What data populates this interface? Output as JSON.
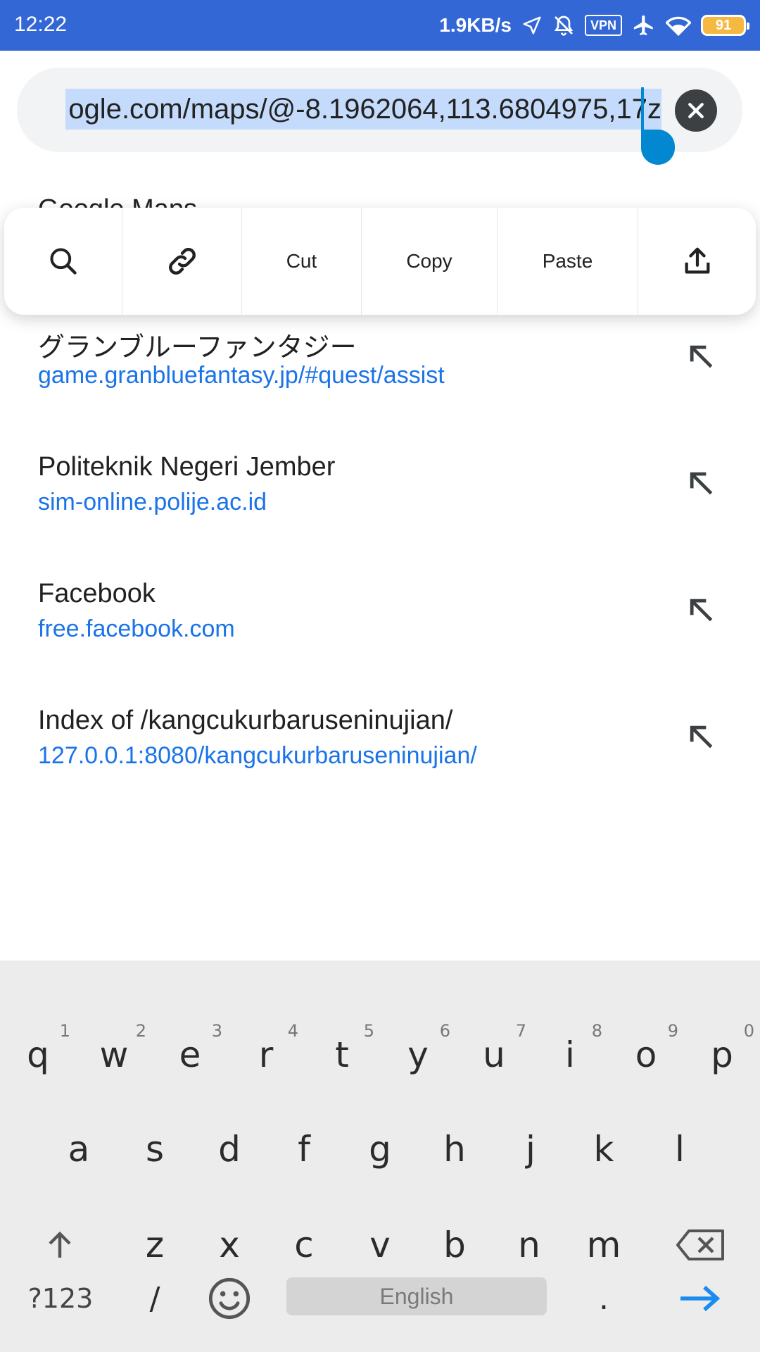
{
  "status_bar": {
    "time": "12:22",
    "net_speed": "1.9KB/s",
    "vpn": "VPN",
    "battery": "91"
  },
  "url_bar": {
    "text": "ogle.com/maps/@-8.1962064,113.6804975,17z"
  },
  "hidden_suggestion_title": "Google Maps",
  "context_menu": {
    "cut": "Cut",
    "copy": "Copy",
    "paste": "Paste"
  },
  "suggestions": [
    {
      "title": "グランブルーファンタジー",
      "url": "game.granbluefantasy.jp/#quest/assist"
    },
    {
      "title": "Politeknik Negeri Jember",
      "url": "sim-online.polije.ac.id"
    },
    {
      "title": "Facebook",
      "url": "free.facebook.com"
    },
    {
      "title": "Index of /kangcukurbaruseninujian/",
      "url": "127.0.0.1:8080/kangcukurbaruseninujian/"
    }
  ],
  "keyboard": {
    "row1": [
      {
        "k": "q",
        "n": "1"
      },
      {
        "k": "w",
        "n": "2"
      },
      {
        "k": "e",
        "n": "3"
      },
      {
        "k": "r",
        "n": "4"
      },
      {
        "k": "t",
        "n": "5"
      },
      {
        "k": "y",
        "n": "6"
      },
      {
        "k": "u",
        "n": "7"
      },
      {
        "k": "i",
        "n": "8"
      },
      {
        "k": "o",
        "n": "9"
      },
      {
        "k": "p",
        "n": "0"
      }
    ],
    "row2": [
      "a",
      "s",
      "d",
      "f",
      "g",
      "h",
      "j",
      "k",
      "l"
    ],
    "row3": [
      "z",
      "x",
      "c",
      "v",
      "b",
      "n",
      "m"
    ],
    "symbols": "?123",
    "slash": "/",
    "space": "English",
    "period": "."
  },
  "colors": {
    "status_bar": "#3367d6",
    "accent": "#1a73e8",
    "selection": "#c5dbfb"
  }
}
